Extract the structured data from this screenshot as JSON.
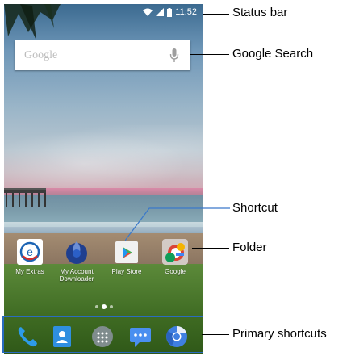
{
  "status_bar": {
    "time": "11:52"
  },
  "search": {
    "placeholder": "Google"
  },
  "apps": [
    {
      "label": "My Extras"
    },
    {
      "label": "My Account Downloader"
    },
    {
      "label": "Play Store"
    },
    {
      "label": "Google"
    }
  ],
  "dock": [
    {
      "icon": "phone-icon"
    },
    {
      "icon": "contacts-icon"
    },
    {
      "icon": "app-drawer-icon"
    },
    {
      "icon": "messaging-icon"
    },
    {
      "icon": "chrome-icon"
    }
  ],
  "callouts": {
    "status_bar": "Status bar",
    "google_search": "Google Search",
    "shortcut": "Shortcut",
    "folder": "Folder",
    "primary_shortcuts": "Primary shortcuts"
  }
}
